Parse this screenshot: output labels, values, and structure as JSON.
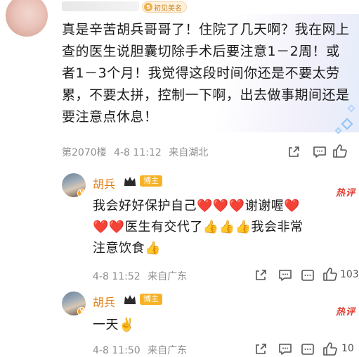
{
  "top_comment": {
    "badge_level": "5",
    "badge_text": "初见美名",
    "text": "真是辛苦胡兵哥哥了！住院了几天啊？我在网上查的医生说胆囊切除手术后要注意1－2周！或者1－3个月！我觉得这段时间你还是不要太劳累，不要太拼，控制一下啊，出去做事期间还是要注意点休息！",
    "floor": "第2070楼",
    "time": "4-8 11:12",
    "location": "来自湖北",
    "icons": [
      "share-icon",
      "comment-icon",
      "more-icon",
      "like-icon"
    ]
  },
  "replies": [
    {
      "author": "胡兵",
      "role_badge": "博主",
      "hot_label": "热评",
      "line1": "我会好好保护自己❤️❤️❤️谢谢喔❤️",
      "line2": "❤️❤️医生有交代了👍👍👍我会非常",
      "line3": "注意饮食👍",
      "time": "4-8 11:52",
      "location": "来自广东",
      "like_count": "103"
    },
    {
      "author": "胡兵",
      "role_badge": "博主",
      "hot_label": "热评",
      "line1": "一天✌️",
      "time": "4-8 11:50",
      "location": "来自广东",
      "like_count": "10"
    }
  ],
  "colors": {
    "author_orange": "#e07d14",
    "hot_red": "#e23b2f",
    "host_badge": "#f6b226",
    "meta_gray": "#8e8e8e"
  }
}
